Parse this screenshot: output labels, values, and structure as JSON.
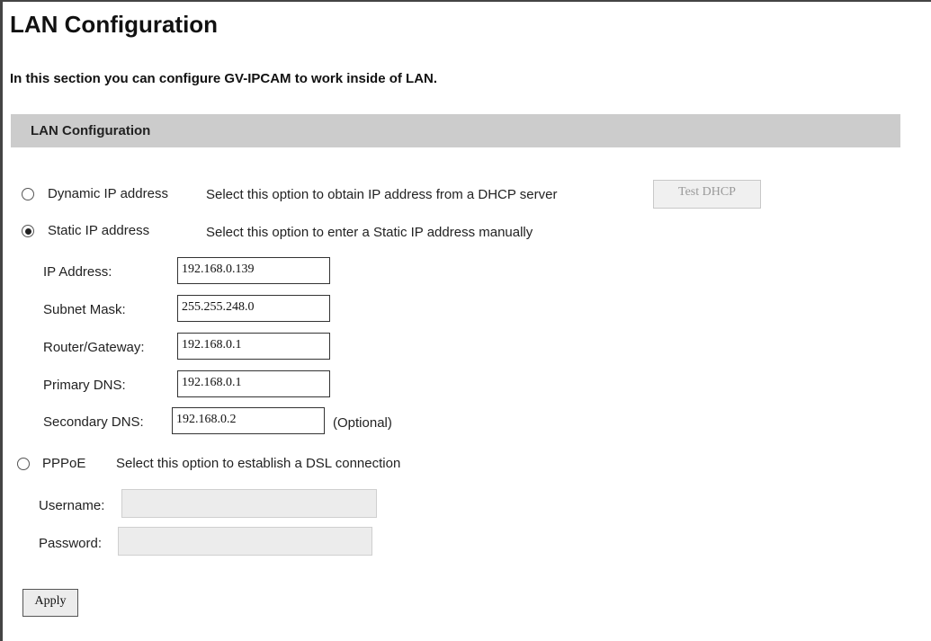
{
  "header": {
    "title": "LAN Configuration",
    "intro": "In this section you can configure GV-IPCAM to work inside of LAN."
  },
  "section": {
    "title": "LAN Configuration"
  },
  "dynamic": {
    "label": "Dynamic IP address",
    "description": "Select this option to obtain IP address from a DHCP server",
    "test_button": "Test DHCP",
    "selected": false
  },
  "static": {
    "label": "Static IP address",
    "description": "Select this option to enter a Static IP address manually",
    "selected": true,
    "fields": {
      "ip_label": "IP Address:",
      "ip_value": "192.168.0.139",
      "subnet_label": "Subnet Mask:",
      "subnet_value": "255.255.248.0",
      "gateway_label": "Router/Gateway:",
      "gateway_value": "192.168.0.1",
      "dns1_label": "Primary DNS:",
      "dns1_value": "192.168.0.1",
      "dns2_label": "Secondary DNS:",
      "dns2_value": "192.168.0.2",
      "optional_note": "(Optional)"
    }
  },
  "pppoe": {
    "label": "PPPoE",
    "description": "Select this option to establish a DSL connection",
    "selected": false,
    "username_label": "Username:",
    "username_value": "",
    "password_label": "Password:",
    "password_value": ""
  },
  "footer": {
    "apply_label": "Apply"
  }
}
